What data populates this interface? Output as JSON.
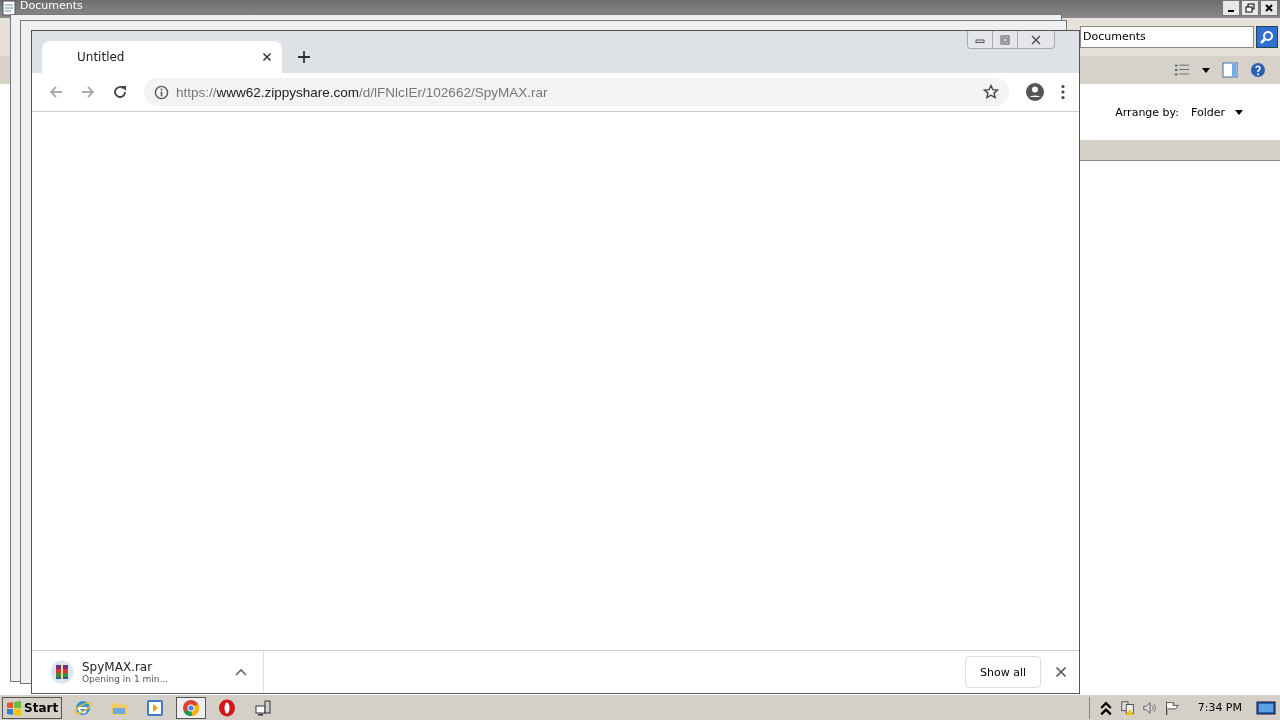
{
  "explorer": {
    "title": "Documents",
    "search": {
      "value": "Documents"
    },
    "arrange_label": "Arrange by:",
    "arrange_value": "Folder"
  },
  "browser": {
    "tabs": [
      {
        "label": "Untitled",
        "selected": true
      }
    ],
    "address": {
      "scheme": "https://",
      "host": "www62.zippyshare.com",
      "path": "/d/lFNlcIEr/102662/SpyMAX.rar"
    },
    "downloads": [
      {
        "name": "SpyMAX.rar",
        "status": "Opening in 1 min..."
      }
    ],
    "show_all": "Show all"
  },
  "taskbar": {
    "start": "Start",
    "apps": [
      {
        "kind": "ie",
        "selected": false
      },
      {
        "kind": "folder",
        "selected": false
      },
      {
        "kind": "media",
        "selected": false
      },
      {
        "kind": "chrome",
        "selected": true
      },
      {
        "kind": "opera",
        "selected": false
      },
      {
        "kind": "network",
        "selected": false
      }
    ],
    "clock": "7:34 PM"
  }
}
